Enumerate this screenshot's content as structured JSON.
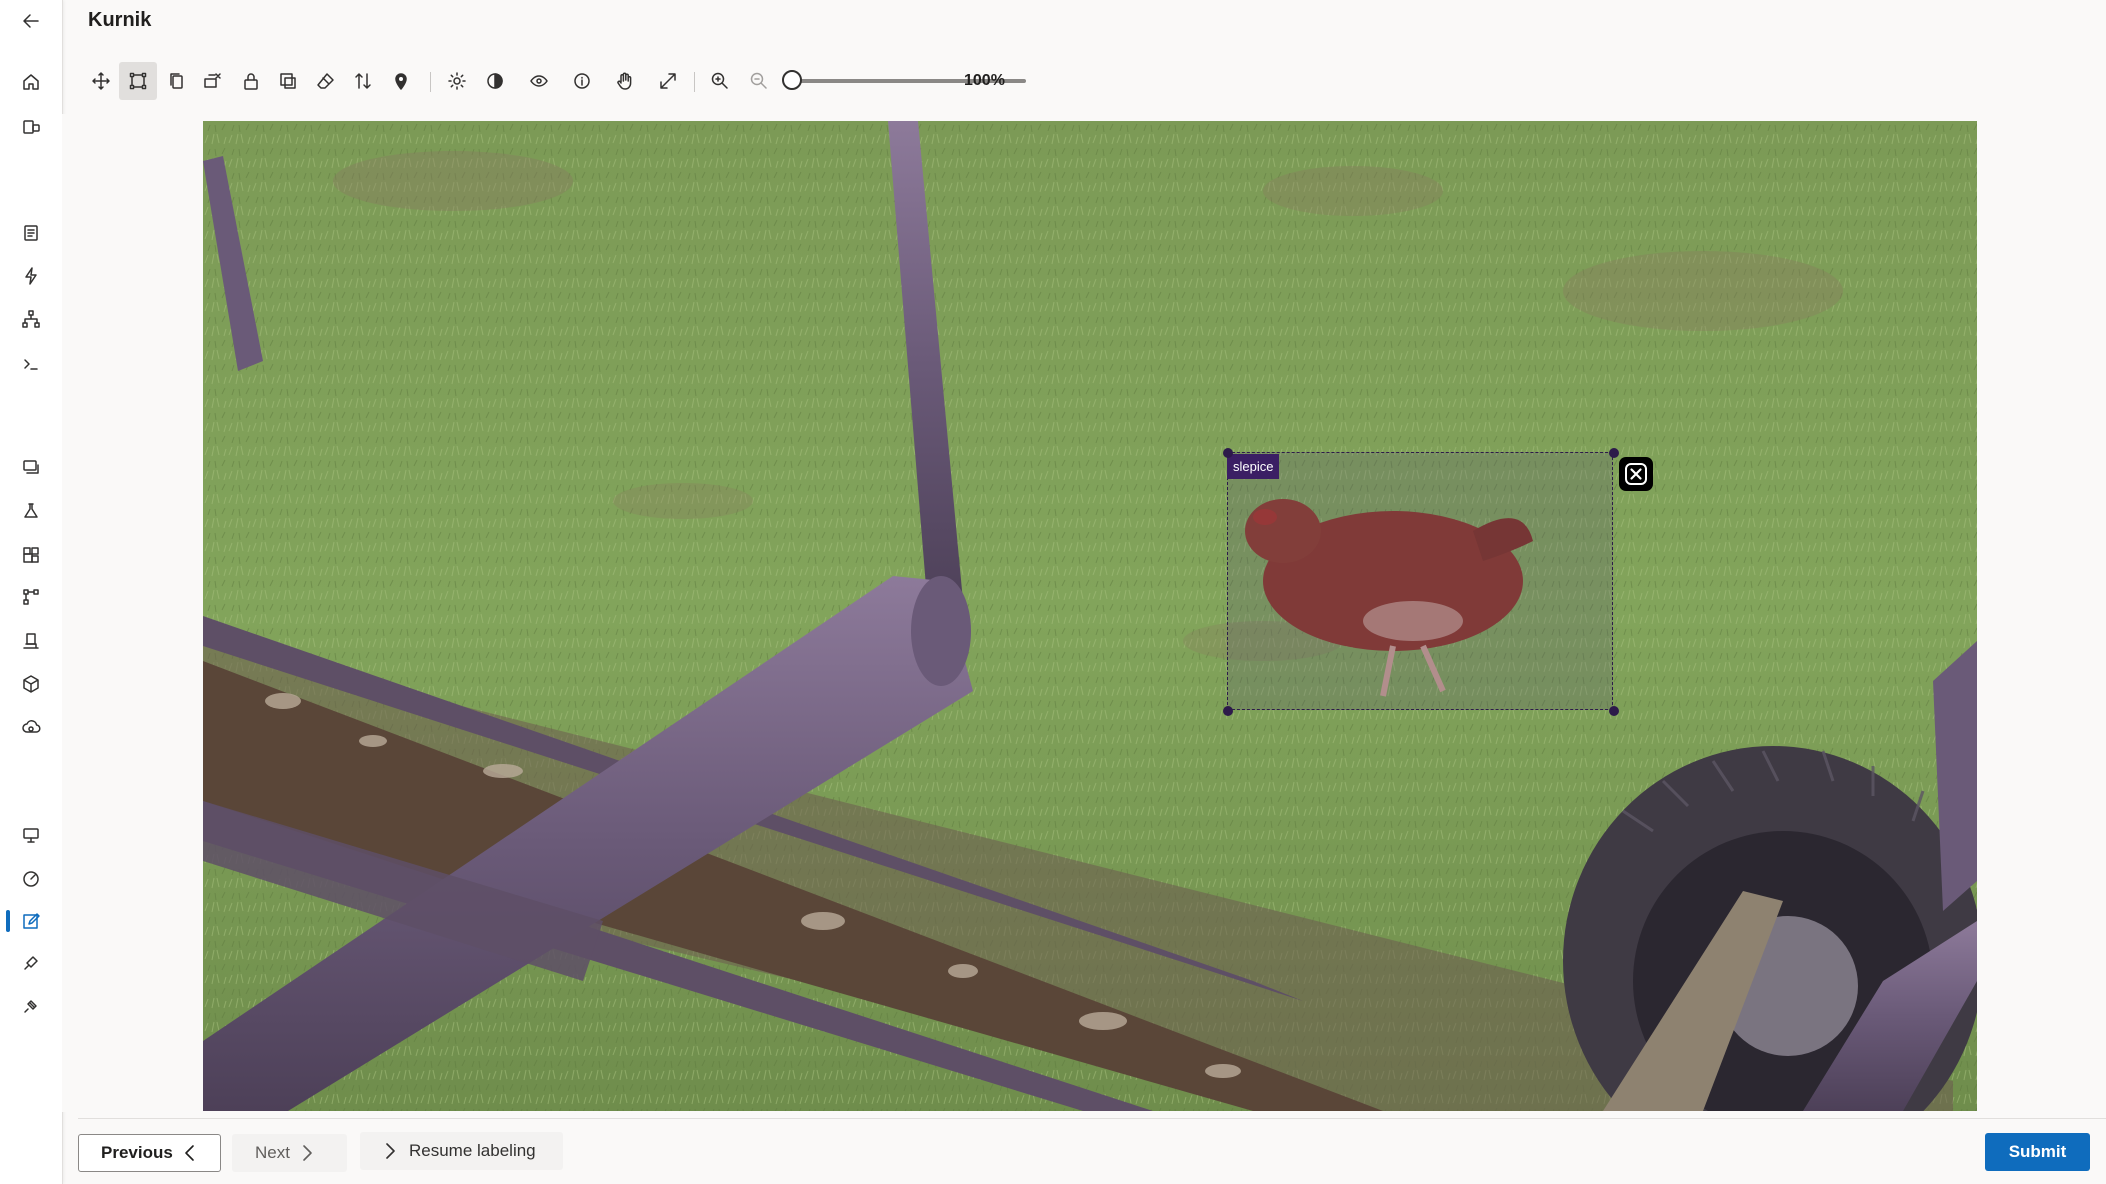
{
  "header": {
    "title": "Kurnik"
  },
  "toolbar": {
    "zoom_label": "100%",
    "zoom_level": 1.0,
    "tools": [
      {
        "name": "move",
        "icon": "move-icon"
      },
      {
        "name": "rectangle",
        "icon": "rectangle-icon",
        "selected": true
      },
      {
        "name": "copy",
        "icon": "copy-icon"
      },
      {
        "name": "delete-region",
        "icon": "delete-region-icon"
      },
      {
        "name": "lock",
        "icon": "lock-icon"
      },
      {
        "name": "select-all",
        "icon": "select-all-icon"
      },
      {
        "name": "eraser",
        "icon": "eraser-icon"
      },
      {
        "name": "sort",
        "icon": "sort-icon"
      },
      {
        "name": "pin",
        "icon": "pin-icon"
      },
      {
        "name": "brightness",
        "icon": "brightness-icon"
      },
      {
        "name": "contrast",
        "icon": "contrast-icon"
      },
      {
        "name": "visibility",
        "icon": "eye-icon"
      },
      {
        "name": "info",
        "icon": "info-icon"
      },
      {
        "name": "pan",
        "icon": "hand-icon"
      },
      {
        "name": "fit",
        "icon": "expand-icon"
      },
      {
        "name": "zoom-in",
        "icon": "zoom-in-icon"
      },
      {
        "name": "zoom-out",
        "icon": "zoom-out-icon",
        "disabled": true
      }
    ]
  },
  "annotation": {
    "label": "slepice"
  },
  "footer": {
    "previous_label": "Previous",
    "next_label": "Next",
    "resume_label": "Resume labeling",
    "submit_label": "Submit"
  },
  "colors": {
    "accent": "#0f6cbd",
    "bbox_label": "#3b1f64"
  },
  "sidebar": {
    "icons": [
      "back-icon",
      "home-icon",
      "model-catalog-icon",
      "notebooks-icon",
      "automl-icon",
      "designer-icon",
      "prompt-flow-icon",
      "data-icon",
      "jobs-icon",
      "components-icon",
      "pipelines-icon",
      "environments-icon",
      "models-icon",
      "endpoints-icon",
      "compute-icon",
      "monitoring-icon",
      "data-labeling-icon",
      "linked-services-icon",
      "connections-icon"
    ]
  }
}
